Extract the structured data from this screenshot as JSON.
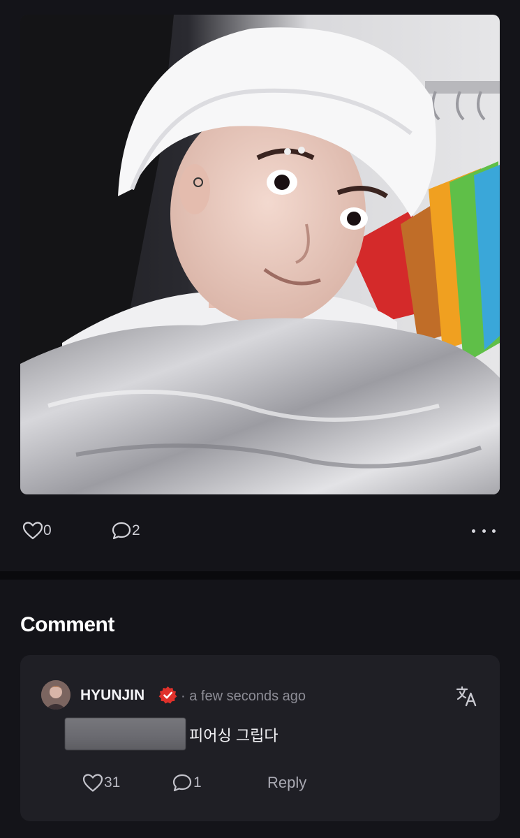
{
  "post": {
    "photo_icon": "photo-selfie-chef-hat",
    "like_count": "0",
    "comment_count": "2",
    "more_icon": "more-horizontal-icon"
  },
  "comments_section": {
    "title": "Comment",
    "comment": {
      "username": "HYUNJIN",
      "timestamp": "· a few seconds ago",
      "text": "피어싱 그립다",
      "like_count": "31",
      "reply_count": "1",
      "reply_label": "Reply"
    }
  },
  "colors": {
    "background": "#141419",
    "card": "#1f1f25",
    "verified_badge": "#e0312b",
    "muted_text": "#8d8d96"
  }
}
